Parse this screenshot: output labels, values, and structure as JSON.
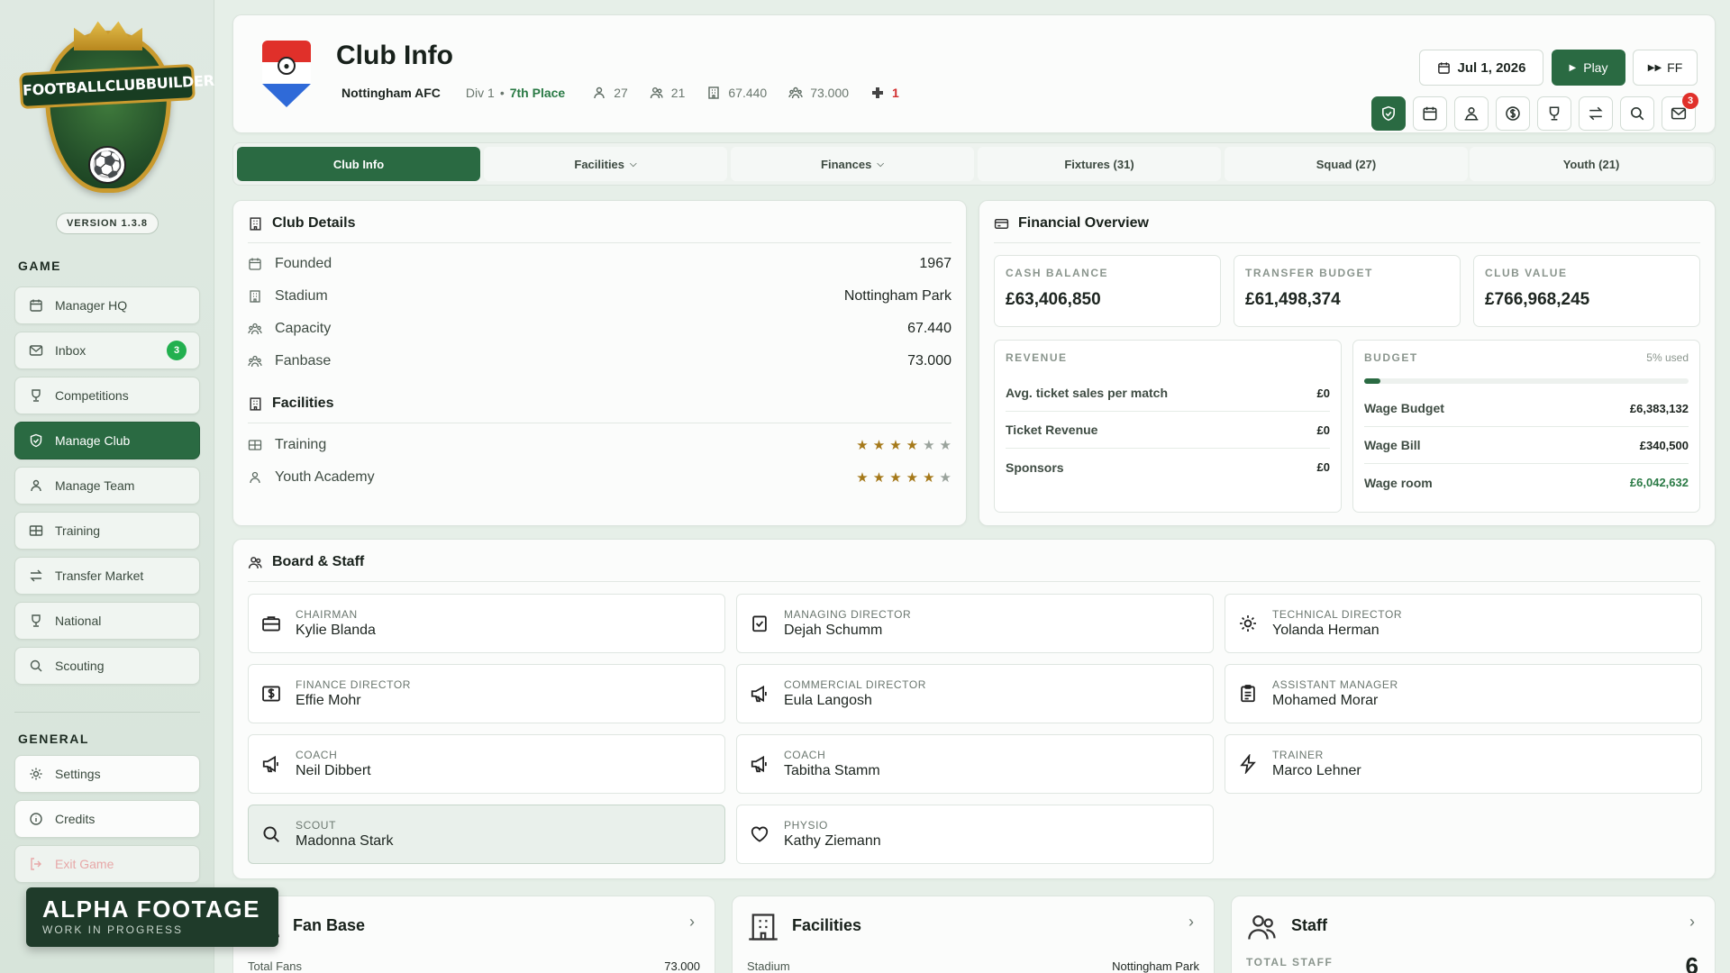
{
  "sidebar": {
    "logo_text": "FOOTBALLCLUBBUILDER",
    "version": "VERSION 1.3.8",
    "game_title": "GAME",
    "game_items": [
      {
        "label": "Manager HQ",
        "icon": "calendar-icon"
      },
      {
        "label": "Inbox",
        "icon": "mail-icon",
        "badge": "3"
      },
      {
        "label": "Competitions",
        "icon": "trophy-icon"
      },
      {
        "label": "Manage Club",
        "icon": "shield-icon",
        "active": true
      },
      {
        "label": "Manage Team",
        "icon": "team-icon"
      },
      {
        "label": "Training",
        "icon": "training-icon"
      },
      {
        "label": "Transfer Market",
        "icon": "transfer-icon"
      },
      {
        "label": "National",
        "icon": "trophy-icon"
      },
      {
        "label": "Scouting",
        "icon": "search-icon"
      }
    ],
    "general_title": "GENERAL",
    "general_items": [
      {
        "label": "Settings",
        "icon": "gear-icon"
      },
      {
        "label": "Credits",
        "icon": "info-icon"
      },
      {
        "label": "Exit Game",
        "icon": "exit-icon"
      }
    ]
  },
  "overlay": {
    "title": "ALPHA FOOTAGE",
    "subtitle": "WORK IN PROGRESS"
  },
  "header": {
    "title": "Club Info",
    "club_name": "Nottingham AFC",
    "division": "Div 1",
    "dot": "•",
    "place": "7th Place",
    "stats": {
      "players": "27",
      "youth": "21",
      "capacity": "67.440",
      "fanbase": "73.000",
      "injuries": "1"
    },
    "date": "Jul 1, 2026",
    "play_label": "Play",
    "ff_label": "FF",
    "notification_count": "3"
  },
  "tabs": [
    {
      "label": "Club Info",
      "active": true
    },
    {
      "label": "Facilities",
      "dropdown": true
    },
    {
      "label": "Finances",
      "dropdown": true
    },
    {
      "label": "Fixtures (31)"
    },
    {
      "label": "Squad (27)"
    },
    {
      "label": "Youth (21)"
    }
  ],
  "club_details": {
    "title": "Club Details",
    "rows": [
      {
        "label": "Founded",
        "value": "1967"
      },
      {
        "label": "Stadium",
        "value": "Nottingham Park"
      },
      {
        "label": "Capacity",
        "value": "67.440"
      },
      {
        "label": "Fanbase",
        "value": "73.000"
      }
    ],
    "facilities_title": "Facilities",
    "facilities": [
      {
        "label": "Training",
        "stars": 4,
        "max": 6
      },
      {
        "label": "Youth Academy",
        "stars": 5,
        "max": 6
      }
    ]
  },
  "financial": {
    "title": "Financial Overview",
    "boxes": [
      {
        "label": "CASH BALANCE",
        "value": "£63,406,850"
      },
      {
        "label": "TRANSFER BUDGET",
        "value": "£61,498,374"
      },
      {
        "label": "CLUB VALUE",
        "value": "£766,968,245"
      }
    ],
    "revenue": {
      "title": "REVENUE",
      "rows": [
        {
          "label": "Avg. ticket sales per match",
          "value": "£0"
        },
        {
          "label": "Ticket Revenue",
          "value": "£0"
        },
        {
          "label": "Sponsors",
          "value": "£0"
        }
      ]
    },
    "budget": {
      "title": "BUDGET",
      "used": "5% used",
      "used_fraction": 0.05,
      "rows": [
        {
          "label": "Wage Budget",
          "value": "£6,383,132"
        },
        {
          "label": "Wage Bill",
          "value": "£340,500"
        },
        {
          "label": "Wage room",
          "value": "£6,042,632",
          "green": true
        }
      ]
    }
  },
  "board": {
    "title": "Board & Staff",
    "staff": [
      {
        "role": "CHAIRMAN",
        "name": "Kylie Blanda",
        "icon": "briefcase-icon"
      },
      {
        "role": "MANAGING DIRECTOR",
        "name": "Dejah Schumm",
        "icon": "clipboard-check-icon"
      },
      {
        "role": "TECHNICAL DIRECTOR",
        "name": "Yolanda Herman",
        "icon": "cog-icon"
      },
      {
        "role": "FINANCE DIRECTOR",
        "name": "Effie Mohr",
        "icon": "dollar-box-icon"
      },
      {
        "role": "COMMERCIAL DIRECTOR",
        "name": "Eula Langosh",
        "icon": "megaphone-icon"
      },
      {
        "role": "ASSISTANT MANAGER",
        "name": "Mohamed Morar",
        "icon": "clipboard-icon"
      },
      {
        "role": "COACH",
        "name": "Neil Dibbert",
        "icon": "megaphone-icon"
      },
      {
        "role": "COACH",
        "name": "Tabitha Stamm",
        "icon": "megaphone-icon"
      },
      {
        "role": "TRAINER",
        "name": "Marco Lehner",
        "icon": "bolt-icon"
      },
      {
        "role": "SCOUT",
        "name": "Madonna Stark",
        "icon": "search-icon",
        "selected": true
      },
      {
        "role": "PHYSIO",
        "name": "Kathy Ziemann",
        "icon": "heart-icon"
      }
    ]
  },
  "bottom_cards": [
    {
      "title": "Fan Base",
      "row_label": "Total Fans",
      "row_value": "73.000"
    },
    {
      "title": "Facilities",
      "row_label": "Stadium",
      "row_value": "Nottingham Park"
    },
    {
      "title": "Staff",
      "label": "TOTAL STAFF",
      "big_value": "6"
    }
  ]
}
